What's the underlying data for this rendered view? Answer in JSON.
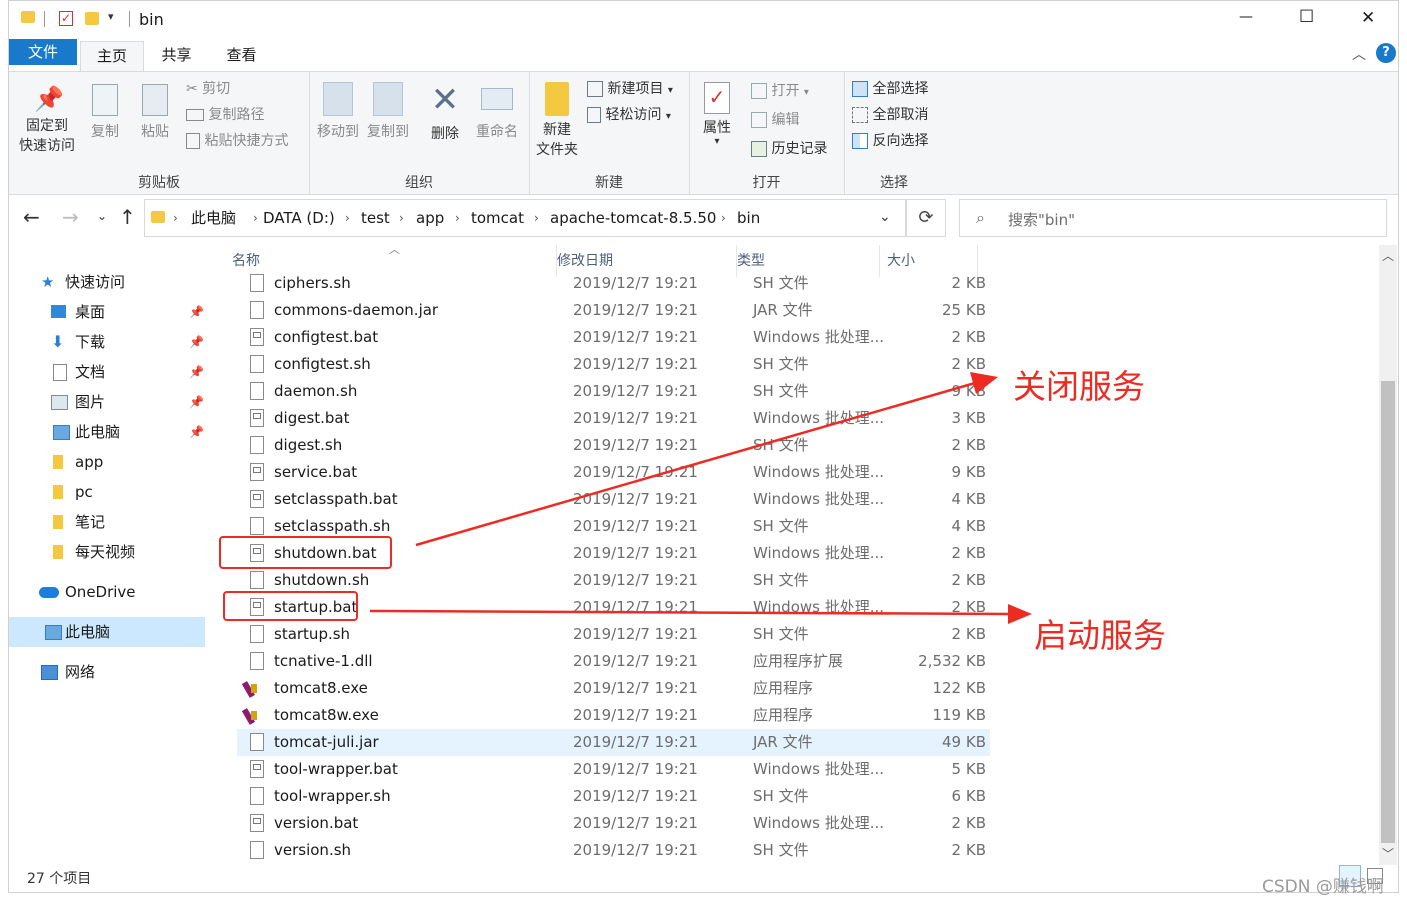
{
  "window": {
    "title": "bin",
    "controls": {
      "minimize": "—",
      "maximize": "☐",
      "close": "✕"
    }
  },
  "tabs": [
    "文件",
    "主页",
    "共享",
    "查看"
  ],
  "active_tab": "主页",
  "ribbon": {
    "clipboard": {
      "label": "剪贴板",
      "pin": "固定到\n快速访问",
      "copy": "复制",
      "paste": "粘贴",
      "cut": "剪切",
      "copy_path": "复制路径",
      "paste_shortcut": "粘贴快捷方式"
    },
    "organize": {
      "label": "组织",
      "move_to": "移动到",
      "copy_to": "复制到",
      "delete": "删除",
      "rename": "重命名"
    },
    "new": {
      "label": "新建",
      "new_folder": "新建\n文件夹",
      "new_item": "新建项目",
      "easy_access": "轻松访问"
    },
    "open": {
      "label": "打开",
      "properties": "属性",
      "open": "打开",
      "edit": "编辑",
      "history": "历史记录"
    },
    "select": {
      "label": "选择",
      "select_all": "全部选择",
      "select_none": "全部取消",
      "invert": "反向选择"
    }
  },
  "breadcrumb": [
    "此电脑",
    "DATA (D:)",
    "test",
    "app",
    "tomcat",
    "apache-tomcat-8.5.50",
    "bin"
  ],
  "search": {
    "placeholder": "搜索\"bin\""
  },
  "sidebar": {
    "quick_access": "快速访问",
    "items": [
      {
        "label": "桌面",
        "pinned": true
      },
      {
        "label": "下载",
        "pinned": true
      },
      {
        "label": "文档",
        "pinned": true
      },
      {
        "label": "图片",
        "pinned": true
      },
      {
        "label": "此电脑",
        "pinned": true
      },
      {
        "label": "app",
        "pinned": false
      },
      {
        "label": "pc",
        "pinned": false
      },
      {
        "label": "笔记",
        "pinned": false
      },
      {
        "label": "每天视频",
        "pinned": false
      }
    ],
    "onedrive": "OneDrive",
    "this_pc": "此电脑",
    "network": "网络"
  },
  "columns": {
    "name": "名称",
    "date": "修改日期",
    "type": "类型",
    "size": "大小"
  },
  "files": [
    {
      "name": "ciphers.sh",
      "date": "2019/12/7 19:21",
      "type": "SH 文件",
      "size": "2 KB",
      "icon": "sh"
    },
    {
      "name": "commons-daemon.jar",
      "date": "2019/12/7 19:21",
      "type": "JAR 文件",
      "size": "25 KB",
      "icon": "sh"
    },
    {
      "name": "configtest.bat",
      "date": "2019/12/7 19:21",
      "type": "Windows 批处理...",
      "size": "2 KB",
      "icon": "bat"
    },
    {
      "name": "configtest.sh",
      "date": "2019/12/7 19:21",
      "type": "SH 文件",
      "size": "2 KB",
      "icon": "sh"
    },
    {
      "name": "daemon.sh",
      "date": "2019/12/7 19:21",
      "type": "SH 文件",
      "size": "9 KB",
      "icon": "sh"
    },
    {
      "name": "digest.bat",
      "date": "2019/12/7 19:21",
      "type": "Windows 批处理...",
      "size": "3 KB",
      "icon": "bat"
    },
    {
      "name": "digest.sh",
      "date": "2019/12/7 19:21",
      "type": "SH 文件",
      "size": "2 KB",
      "icon": "sh"
    },
    {
      "name": "service.bat",
      "date": "2019/12/7 19:21",
      "type": "Windows 批处理...",
      "size": "9 KB",
      "icon": "bat"
    },
    {
      "name": "setclasspath.bat",
      "date": "2019/12/7 19:21",
      "type": "Windows 批处理...",
      "size": "4 KB",
      "icon": "bat"
    },
    {
      "name": "setclasspath.sh",
      "date": "2019/12/7 19:21",
      "type": "SH 文件",
      "size": "4 KB",
      "icon": "sh"
    },
    {
      "name": "shutdown.bat",
      "date": "2019/12/7 19:21",
      "type": "Windows 批处理...",
      "size": "2 KB",
      "icon": "bat"
    },
    {
      "name": "shutdown.sh",
      "date": "2019/12/7 19:21",
      "type": "SH 文件",
      "size": "2 KB",
      "icon": "sh"
    },
    {
      "name": "startup.bat",
      "date": "2019/12/7 19:21",
      "type": "Windows 批处理...",
      "size": "2 KB",
      "icon": "bat"
    },
    {
      "name": "startup.sh",
      "date": "2019/12/7 19:21",
      "type": "SH 文件",
      "size": "2 KB",
      "icon": "sh"
    },
    {
      "name": "tcnative-1.dll",
      "date": "2019/12/7 19:21",
      "type": "应用程序扩展",
      "size": "2,532 KB",
      "icon": "sh"
    },
    {
      "name": "tomcat8.exe",
      "date": "2019/12/7 19:21",
      "type": "应用程序",
      "size": "122 KB",
      "icon": "exe"
    },
    {
      "name": "tomcat8w.exe",
      "date": "2019/12/7 19:21",
      "type": "应用程序",
      "size": "119 KB",
      "icon": "exe"
    },
    {
      "name": "tomcat-juli.jar",
      "date": "2019/12/7 19:21",
      "type": "JAR 文件",
      "size": "49 KB",
      "icon": "sh",
      "selected": true
    },
    {
      "name": "tool-wrapper.bat",
      "date": "2019/12/7 19:21",
      "type": "Windows 批处理...",
      "size": "5 KB",
      "icon": "bat"
    },
    {
      "name": "tool-wrapper.sh",
      "date": "2019/12/7 19:21",
      "type": "SH 文件",
      "size": "6 KB",
      "icon": "sh"
    },
    {
      "name": "version.bat",
      "date": "2019/12/7 19:21",
      "type": "Windows 批处理...",
      "size": "2 KB",
      "icon": "bat"
    },
    {
      "name": "version.sh",
      "date": "2019/12/7 19:21",
      "type": "SH 文件",
      "size": "2 KB",
      "icon": "sh"
    }
  ],
  "status": {
    "count": "27 个项目"
  },
  "annotations": {
    "shutdown_label": "关闭服务",
    "startup_label": "启动服务",
    "color": "#ec2c23"
  },
  "watermark": "CSDN @赚钱啊",
  "colors": {
    "accent": "#1979ca",
    "selected_row": "#e5f3ff",
    "sidebar_selected": "#cce8ff"
  }
}
